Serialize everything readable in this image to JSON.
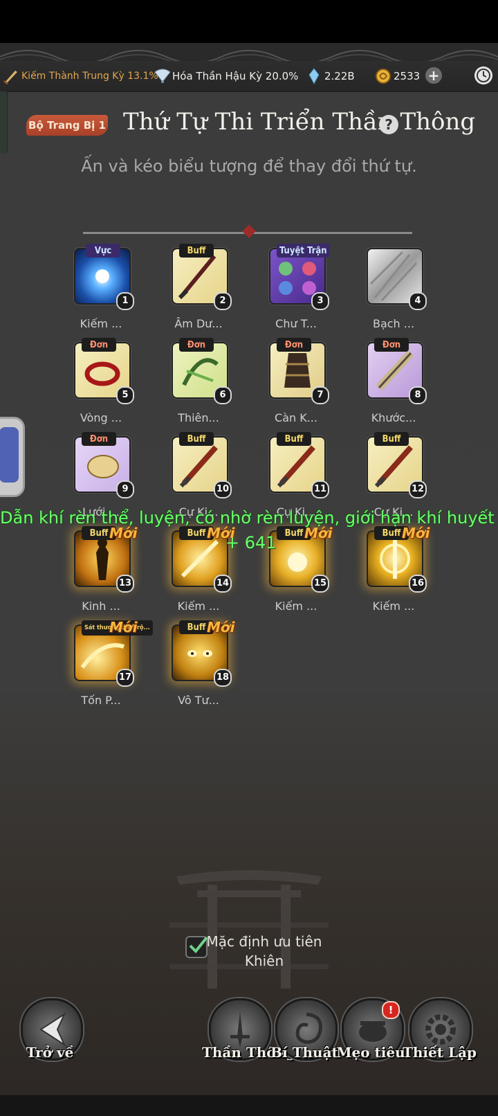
{
  "resources": {
    "cultivation": "Kiếm Thành Trung Kỳ 13.1%",
    "realm": "Hóa Thần Hậu Kỳ 20.0%",
    "spirit_stones": "2.22B",
    "currency": "2533"
  },
  "header": {
    "set_label": "Bộ Trang Bị 1",
    "title": "Thứ Tự Thi Triển Thần Thông",
    "subtitle": "Ấn và kéo biểu tượng để thay đổi thứ tự."
  },
  "skills": [
    {
      "tag": "Vực",
      "num": "1",
      "name": "Kiếm ...",
      "new": ""
    },
    {
      "tag": "Buff",
      "num": "2",
      "name": "Âm Dư...",
      "new": ""
    },
    {
      "tag": "Tuyệt Trận",
      "num": "3",
      "name": "Chư T...",
      "new": ""
    },
    {
      "tag": "",
      "num": "4",
      "name": "Bạch ...",
      "new": ""
    },
    {
      "tag": "Đơn",
      "num": "5",
      "name": "Vòng ...",
      "new": ""
    },
    {
      "tag": "Đơn",
      "num": "6",
      "name": "Thiên...",
      "new": ""
    },
    {
      "tag": "Đơn",
      "num": "7",
      "name": "Càn K...",
      "new": ""
    },
    {
      "tag": "Đơn",
      "num": "8",
      "name": "Khước...",
      "new": ""
    },
    {
      "tag": "Đơn",
      "num": "9",
      "name": "Lưới ...",
      "new": ""
    },
    {
      "tag": "Buff",
      "num": "10",
      "name": "Cự Ki...",
      "new": ""
    },
    {
      "tag": "Buff",
      "num": "11",
      "name": "Cự Ki...",
      "new": ""
    },
    {
      "tag": "Buff",
      "num": "12",
      "name": "Cự Ki...",
      "new": ""
    },
    {
      "tag": "Buff",
      "num": "13",
      "name": "Kinh ...",
      "new": "Mới"
    },
    {
      "tag": "Buff",
      "num": "14",
      "name": "Kiếm ...",
      "new": "Mới"
    },
    {
      "tag": "Buff",
      "num": "15",
      "name": "Kiếm ...",
      "new": "Mới"
    },
    {
      "tag": "Buff",
      "num": "16",
      "name": "Kiếm ...",
      "new": "Mới"
    },
    {
      "tag": "Sát thương diện rộ...",
      "num": "17",
      "name": "Tốn P...",
      "new": "Mới"
    },
    {
      "tag": "Buff",
      "num": "18",
      "name": "Vô Tư...",
      "new": "Mới"
    }
  ],
  "floating_message": {
    "text": "Dẫn khí rèn thể, luyện, có nhờ rèn luyện, giới hạn khí huyết",
    "value": "+ 641"
  },
  "default_priority_label": "Mặc định ưu tiên Khiên",
  "nav": {
    "back": "Trở về",
    "than_thong": "Thần Thông",
    "bi_thuat": "Bí Thuật",
    "muo_tieu": "Mẹo tiêu",
    "settings": "Thiết Lập"
  },
  "colors": {
    "background": "#3c3c3c",
    "accent_gold": "#f5b740",
    "float_text": "#6cff6c",
    "badge_red": "#c85a3a"
  }
}
